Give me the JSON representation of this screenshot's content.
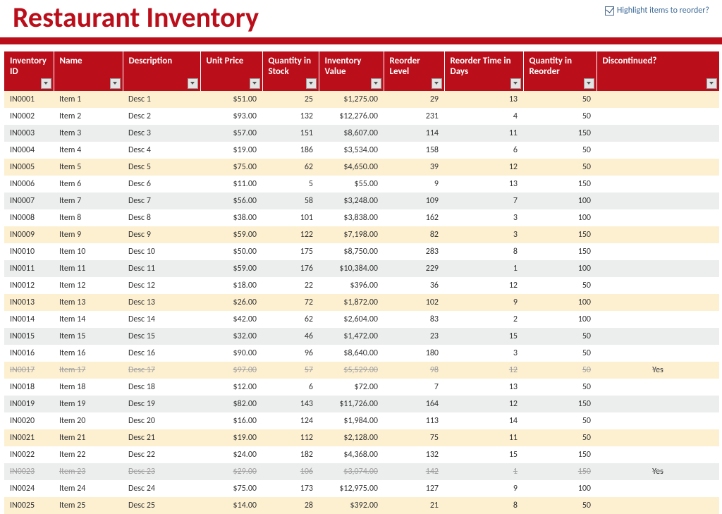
{
  "header": {
    "title": "Restaurant Inventory",
    "highlight_label": "Highlight items to reorder?",
    "highlight_checked": true
  },
  "columns": [
    {
      "key": "id",
      "label": "Inventory ID",
      "type": "text"
    },
    {
      "key": "name",
      "label": "Name",
      "type": "text"
    },
    {
      "key": "desc",
      "label": "Description",
      "type": "text"
    },
    {
      "key": "price",
      "label": "Unit Price",
      "type": "money"
    },
    {
      "key": "qty",
      "label": "Quantity in Stock",
      "type": "int"
    },
    {
      "key": "value",
      "label": "Inventory Value",
      "type": "money"
    },
    {
      "key": "rlvl",
      "label": "Reorder Level",
      "type": "int"
    },
    {
      "key": "rtime",
      "label": "Reorder Time in Days",
      "type": "int"
    },
    {
      "key": "rqty",
      "label": "Quantity in Reorder",
      "type": "int"
    },
    {
      "key": "disc",
      "label": "Discontinued?",
      "type": "flag"
    }
  ],
  "row_shades": [
    "cream",
    "white",
    "grey",
    "white"
  ],
  "rows": [
    {
      "id": "IN0001",
      "name": "Item 1",
      "desc": "Desc 1",
      "price": 51,
      "qty": 25,
      "value": 1275,
      "rlvl": 29,
      "rtime": 13,
      "rqty": 50,
      "disc": false
    },
    {
      "id": "IN0002",
      "name": "Item 2",
      "desc": "Desc 2",
      "price": 93,
      "qty": 132,
      "value": 12276,
      "rlvl": 231,
      "rtime": 4,
      "rqty": 50,
      "disc": false
    },
    {
      "id": "IN0003",
      "name": "Item 3",
      "desc": "Desc 3",
      "price": 57,
      "qty": 151,
      "value": 8607,
      "rlvl": 114,
      "rtime": 11,
      "rqty": 150,
      "disc": false
    },
    {
      "id": "IN0004",
      "name": "Item 4",
      "desc": "Desc 4",
      "price": 19,
      "qty": 186,
      "value": 3534,
      "rlvl": 158,
      "rtime": 6,
      "rqty": 50,
      "disc": false
    },
    {
      "id": "IN0005",
      "name": "Item 5",
      "desc": "Desc 5",
      "price": 75,
      "qty": 62,
      "value": 4650,
      "rlvl": 39,
      "rtime": 12,
      "rqty": 50,
      "disc": false
    },
    {
      "id": "IN0006",
      "name": "Item 6",
      "desc": "Desc 6",
      "price": 11,
      "qty": 5,
      "value": 55,
      "rlvl": 9,
      "rtime": 13,
      "rqty": 150,
      "disc": false
    },
    {
      "id": "IN0007",
      "name": "Item 7",
      "desc": "Desc 7",
      "price": 56,
      "qty": 58,
      "value": 3248,
      "rlvl": 109,
      "rtime": 7,
      "rqty": 100,
      "disc": false
    },
    {
      "id": "IN0008",
      "name": "Item 8",
      "desc": "Desc 8",
      "price": 38,
      "qty": 101,
      "value": 3838,
      "rlvl": 162,
      "rtime": 3,
      "rqty": 100,
      "disc": false
    },
    {
      "id": "IN0009",
      "name": "Item 9",
      "desc": "Desc 9",
      "price": 59,
      "qty": 122,
      "value": 7198,
      "rlvl": 82,
      "rtime": 3,
      "rqty": 150,
      "disc": false
    },
    {
      "id": "IN0010",
      "name": "Item 10",
      "desc": "Desc 10",
      "price": 50,
      "qty": 175,
      "value": 8750,
      "rlvl": 283,
      "rtime": 8,
      "rqty": 150,
      "disc": false
    },
    {
      "id": "IN0011",
      "name": "Item 11",
      "desc": "Desc 11",
      "price": 59,
      "qty": 176,
      "value": 10384,
      "rlvl": 229,
      "rtime": 1,
      "rqty": 100,
      "disc": false
    },
    {
      "id": "IN0012",
      "name": "Item 12",
      "desc": "Desc 12",
      "price": 18,
      "qty": 22,
      "value": 396,
      "rlvl": 36,
      "rtime": 12,
      "rqty": 50,
      "disc": false
    },
    {
      "id": "IN0013",
      "name": "Item 13",
      "desc": "Desc 13",
      "price": 26,
      "qty": 72,
      "value": 1872,
      "rlvl": 102,
      "rtime": 9,
      "rqty": 100,
      "disc": false
    },
    {
      "id": "IN0014",
      "name": "Item 14",
      "desc": "Desc 14",
      "price": 42,
      "qty": 62,
      "value": 2604,
      "rlvl": 83,
      "rtime": 2,
      "rqty": 100,
      "disc": false
    },
    {
      "id": "IN0015",
      "name": "Item 15",
      "desc": "Desc 15",
      "price": 32,
      "qty": 46,
      "value": 1472,
      "rlvl": 23,
      "rtime": 15,
      "rqty": 50,
      "disc": false
    },
    {
      "id": "IN0016",
      "name": "Item 16",
      "desc": "Desc 16",
      "price": 90,
      "qty": 96,
      "value": 8640,
      "rlvl": 180,
      "rtime": 3,
      "rqty": 50,
      "disc": false
    },
    {
      "id": "IN0017",
      "name": "Item 17",
      "desc": "Desc 17",
      "price": 97,
      "qty": 57,
      "value": 5529,
      "rlvl": 98,
      "rtime": 12,
      "rqty": 50,
      "disc": true
    },
    {
      "id": "IN0018",
      "name": "Item 18",
      "desc": "Desc 18",
      "price": 12,
      "qty": 6,
      "value": 72,
      "rlvl": 7,
      "rtime": 13,
      "rqty": 50,
      "disc": false
    },
    {
      "id": "IN0019",
      "name": "Item 19",
      "desc": "Desc 19",
      "price": 82,
      "qty": 143,
      "value": 11726,
      "rlvl": 164,
      "rtime": 12,
      "rqty": 150,
      "disc": false
    },
    {
      "id": "IN0020",
      "name": "Item 20",
      "desc": "Desc 20",
      "price": 16,
      "qty": 124,
      "value": 1984,
      "rlvl": 113,
      "rtime": 14,
      "rqty": 50,
      "disc": false
    },
    {
      "id": "IN0021",
      "name": "Item 21",
      "desc": "Desc 21",
      "price": 19,
      "qty": 112,
      "value": 2128,
      "rlvl": 75,
      "rtime": 11,
      "rqty": 50,
      "disc": false
    },
    {
      "id": "IN0022",
      "name": "Item 22",
      "desc": "Desc 22",
      "price": 24,
      "qty": 182,
      "value": 4368,
      "rlvl": 132,
      "rtime": 15,
      "rqty": 150,
      "disc": false
    },
    {
      "id": "IN0023",
      "name": "Item 23",
      "desc": "Desc 23",
      "price": 29,
      "qty": 106,
      "value": 3074,
      "rlvl": 142,
      "rtime": 1,
      "rqty": 150,
      "disc": true
    },
    {
      "id": "IN0024",
      "name": "Item 24",
      "desc": "Desc 24",
      "price": 75,
      "qty": 173,
      "value": 12975,
      "rlvl": 127,
      "rtime": 9,
      "rqty": 100,
      "disc": false
    },
    {
      "id": "IN0025",
      "name": "Item 25",
      "desc": "Desc 25",
      "price": 14,
      "qty": 28,
      "value": 392,
      "rlvl": 21,
      "rtime": 8,
      "rqty": 50,
      "disc": false
    }
  ],
  "discontinued_label": "Yes"
}
